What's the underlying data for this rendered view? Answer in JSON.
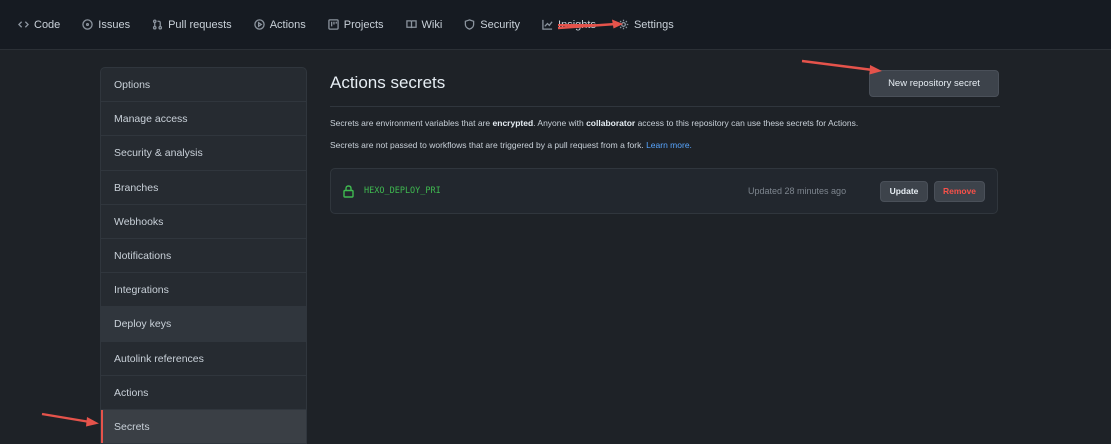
{
  "nav": {
    "tabs": [
      {
        "label": "Code",
        "icon": "code-icon"
      },
      {
        "label": "Issues",
        "icon": "issue-icon"
      },
      {
        "label": "Pull requests",
        "icon": "pull-request-icon"
      },
      {
        "label": "Actions",
        "icon": "play-icon"
      },
      {
        "label": "Projects",
        "icon": "project-icon"
      },
      {
        "label": "Wiki",
        "icon": "book-icon"
      },
      {
        "label": "Security",
        "icon": "shield-icon"
      },
      {
        "label": "Insights",
        "icon": "graph-icon"
      },
      {
        "label": "Settings",
        "icon": "gear-icon"
      }
    ]
  },
  "sidebar": {
    "items": [
      {
        "label": "Options"
      },
      {
        "label": "Manage access"
      },
      {
        "label": "Security & analysis"
      },
      {
        "label": "Branches"
      },
      {
        "label": "Webhooks"
      },
      {
        "label": "Notifications"
      },
      {
        "label": "Integrations"
      },
      {
        "label": "Deploy keys"
      },
      {
        "label": "Autolink references"
      },
      {
        "label": "Actions"
      },
      {
        "label": "Secrets"
      }
    ]
  },
  "main": {
    "title": "Actions secrets",
    "new_secret_label": "New repository secret",
    "desc1": {
      "part1": "Secrets are environment variables that are ",
      "bold1": "encrypted",
      "part2": ". Anyone with ",
      "bold2": "collaborator",
      "part3": " access to this repository can use these secrets for Actions."
    },
    "desc2": {
      "text": "Secrets are not passed to workflows that are triggered by a pull request from a fork. ",
      "link": "Learn more."
    },
    "secret": {
      "name": "HEXO_DEPLOY_PRI",
      "updated": "Updated 28 minutes ago",
      "update_label": "Update",
      "remove_label": "Remove"
    }
  },
  "colors": {
    "accent_red": "#e5534b",
    "secret_green": "#3fb950",
    "link_blue": "#58a6ff"
  }
}
